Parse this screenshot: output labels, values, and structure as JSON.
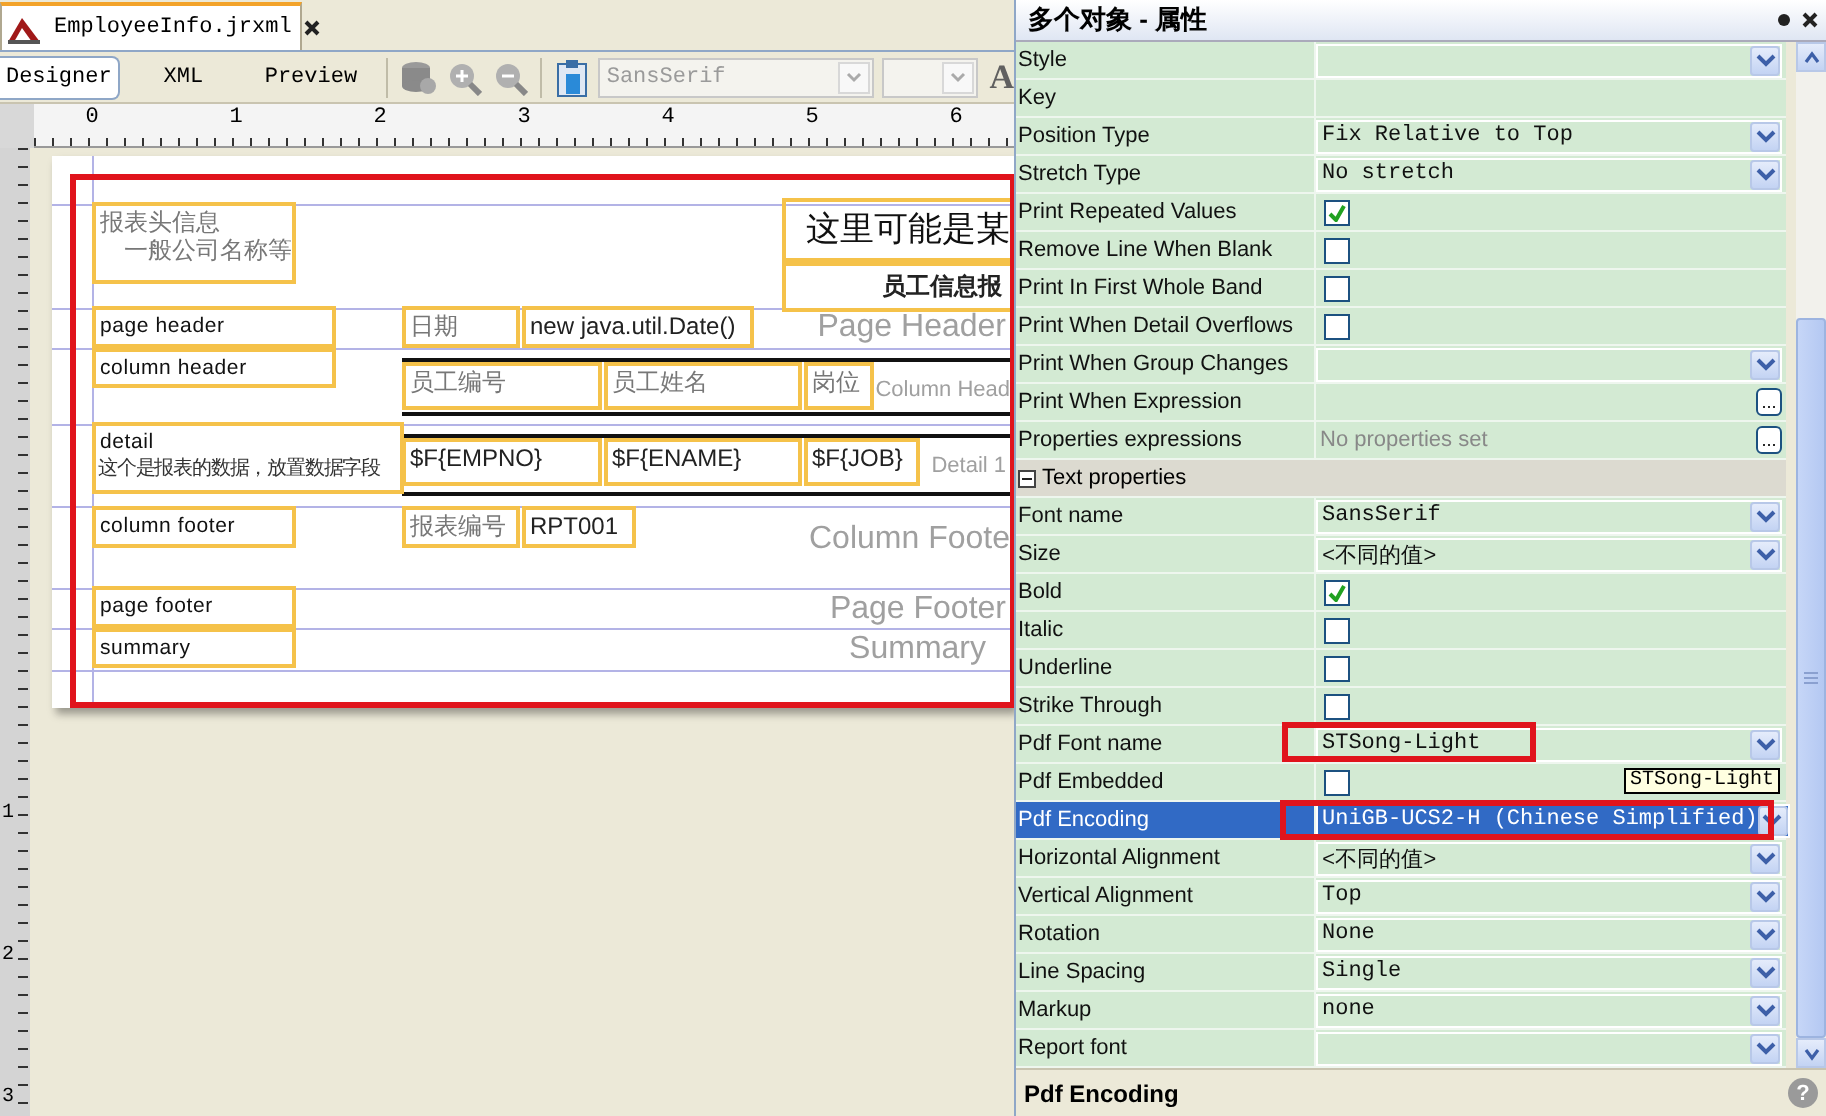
{
  "document_tab": {
    "title": "EmployeeInfo.jrxml"
  },
  "view_tabs": [
    {
      "label": "Designer",
      "selected": true
    },
    {
      "label": "XML",
      "selected": false
    },
    {
      "label": "Preview",
      "selected": false
    }
  ],
  "toolbar": {
    "font_family": "SansSerif",
    "disabled": true,
    "text_icon": "A"
  },
  "ruler": {
    "horizontal": [
      "0",
      "1",
      "2",
      "3",
      "4",
      "5",
      "6"
    ],
    "vertical": [
      "1",
      "2",
      "3"
    ]
  },
  "report": {
    "elements": [
      {
        "kind": "static",
        "lines": [
          "报表头信息",
          "一般公司名称等"
        ]
      },
      {
        "kind": "title",
        "lines": [
          "这里可能是某"
        ]
      },
      {
        "kind": "subtitle",
        "lines": [
          "员工信息报"
        ]
      },
      {
        "kind": "note",
        "lines": [
          "page header"
        ]
      },
      {
        "kind": "note",
        "lines": [
          "column header"
        ]
      },
      {
        "kind": "note",
        "lines": [
          "detail",
          "这个是报表的数据，放置数据字段"
        ]
      },
      {
        "kind": "note",
        "lines": [
          "column footer"
        ]
      },
      {
        "kind": "note",
        "lines": [
          "page footer"
        ]
      },
      {
        "kind": "note",
        "lines": [
          "summary"
        ]
      },
      {
        "kind": "static",
        "lines": [
          "日期"
        ]
      },
      {
        "kind": "field",
        "lines": [
          "new java.util.Date()"
        ]
      },
      {
        "kind": "static",
        "lines": [
          "员工编号"
        ]
      },
      {
        "kind": "static",
        "lines": [
          "员工姓名"
        ]
      },
      {
        "kind": "static",
        "lines": [
          "岗位"
        ]
      },
      {
        "kind": "field",
        "lines": [
          "$F{EMPNO}"
        ]
      },
      {
        "kind": "field",
        "lines": [
          "$F{ENAME}"
        ]
      },
      {
        "kind": "field",
        "lines": [
          "$F{JOB}"
        ]
      },
      {
        "kind": "static",
        "lines": [
          "报表编号"
        ]
      },
      {
        "kind": "field",
        "lines": [
          "RPT001"
        ]
      }
    ],
    "band_labels": [
      "Page Header",
      "Column Head",
      "Detail 1",
      "Column Foote",
      "Page Footer",
      "Summary"
    ]
  },
  "properties": {
    "title": "多个对象 - 属性",
    "tooltip": "STSong-Light",
    "rows": [
      {
        "kind": "combo",
        "label": "Style",
        "selected": false
      },
      {
        "kind": "plain",
        "label": "Key",
        "selected": false
      },
      {
        "kind": "combo",
        "label": "Position Type",
        "value": "Fix Relative to Top",
        "selected": false
      },
      {
        "kind": "combo",
        "label": "Stretch Type",
        "value": "No stretch",
        "selected": false
      },
      {
        "kind": "check",
        "label": "Print Repeated Values",
        "checked": true,
        "selected": false
      },
      {
        "kind": "check",
        "label": "Remove Line When Blank",
        "checked": false,
        "selected": false
      },
      {
        "kind": "check",
        "label": "Print In First Whole Band",
        "checked": false,
        "selected": false
      },
      {
        "kind": "check",
        "label": "Print When Detail Overflows",
        "checked": false,
        "selected": false
      },
      {
        "kind": "combo",
        "label": "Print When Group Changes",
        "selected": false
      },
      {
        "kind": "dialog",
        "label": "Print When Expression",
        "button": "...",
        "selected": false
      },
      {
        "kind": "dialog",
        "label": "Properties expressions",
        "value": "No properties set",
        "button": "...",
        "selected": false
      },
      {
        "kind": "section",
        "label": "Text properties",
        "expanded": true,
        "selected": false
      },
      {
        "kind": "combo",
        "label": "Font name",
        "value": "SansSerif",
        "selected": false
      },
      {
        "kind": "combo",
        "label": "Size",
        "value": "<不同的值>",
        "selected": false
      },
      {
        "kind": "check",
        "label": "Bold",
        "checked": true,
        "selected": false
      },
      {
        "kind": "check",
        "label": "Italic",
        "checked": false,
        "selected": false
      },
      {
        "kind": "check",
        "label": "Underline",
        "checked": false,
        "selected": false
      },
      {
        "kind": "check",
        "label": "Strike Through",
        "checked": false,
        "selected": false
      },
      {
        "kind": "combo",
        "label": "Pdf Font name",
        "value": "STSong-Light",
        "selected": false
      },
      {
        "kind": "check",
        "label": "Pdf Embedded",
        "checked": false,
        "selected": false
      },
      {
        "kind": "combo",
        "label": "Pdf Encoding",
        "value": "UniGB-UCS2-H (Chinese Simplified)",
        "selected": true
      },
      {
        "kind": "combo",
        "label": "Horizontal Alignment",
        "value": "<不同的值>",
        "selected": false
      },
      {
        "kind": "combo",
        "label": "Vertical Alignment",
        "value": "Top",
        "selected": false
      },
      {
        "kind": "combo",
        "label": "Rotation",
        "value": "None",
        "selected": false
      },
      {
        "kind": "combo",
        "label": "Line Spacing",
        "value": "Single",
        "selected": false
      },
      {
        "kind": "combo",
        "label": "Markup",
        "value": "none",
        "selected": false
      },
      {
        "kind": "combo",
        "label": "Report font",
        "selected": false
      }
    ],
    "description": {
      "title": "Pdf Encoding",
      "help": "?"
    }
  }
}
